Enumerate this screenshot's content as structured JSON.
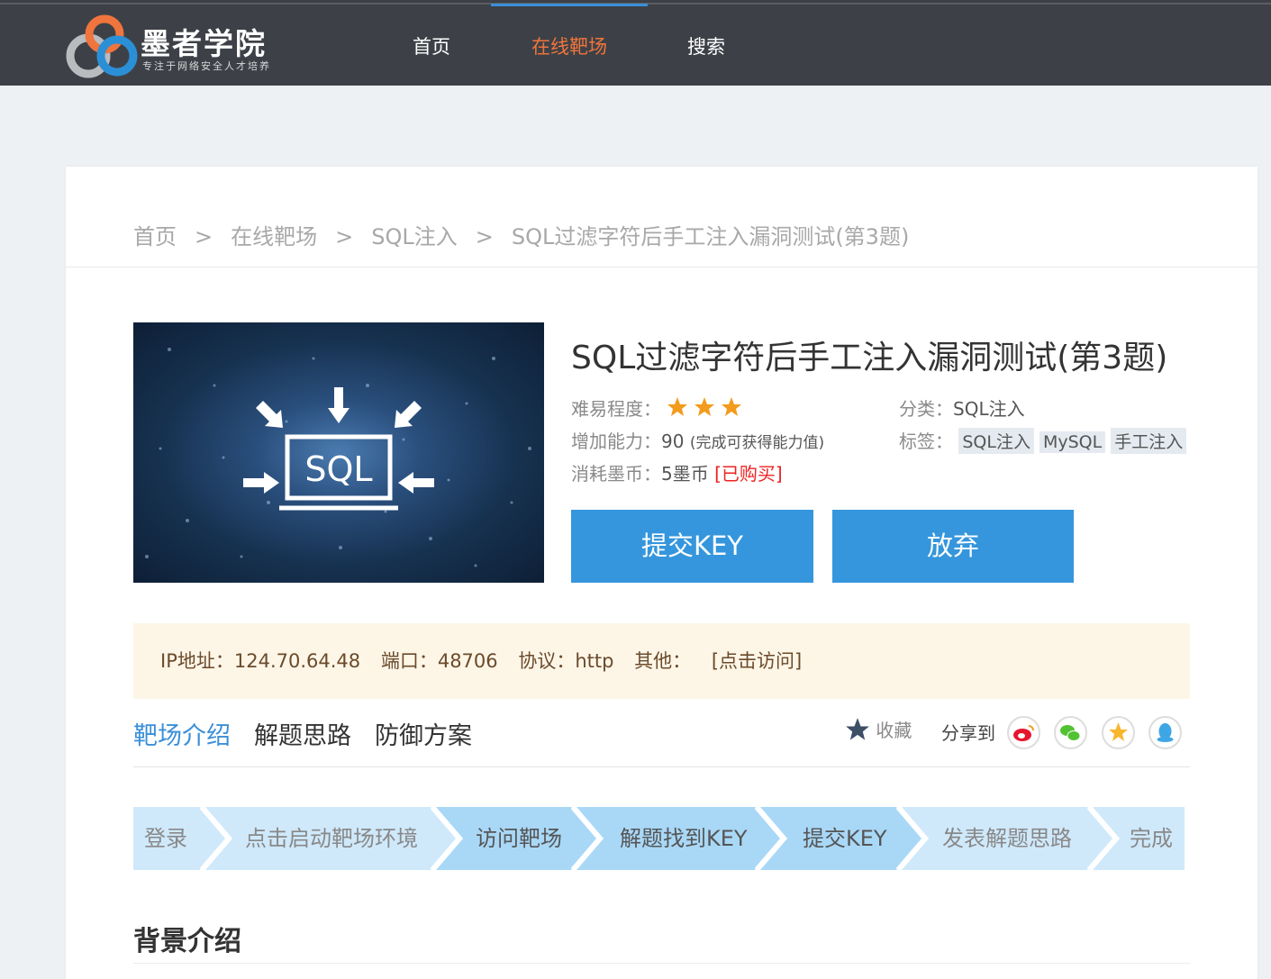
{
  "header": {
    "logo_title": "墨者学院",
    "logo_subtitle": "专注于网络安全人才培养",
    "nav": [
      {
        "label": "首页"
      },
      {
        "label": "在线靶场"
      },
      {
        "label": "搜索"
      }
    ],
    "active_nav": "在线靶场",
    "active_color": "#f0743d"
  },
  "breadcrumb": [
    "首页",
    "在线靶场",
    "SQL注入",
    "SQL过滤字符后手工注入漏洞测试(第3题)"
  ],
  "breadcrumb_sep": ">",
  "hero_image": {
    "text": "SQL"
  },
  "challenge": {
    "title": "SQL过滤字符后手工注入漏洞测试(第3题)",
    "difficulty_label": "难易程度：",
    "difficulty_stars": 3,
    "ability_label": "增加能力：",
    "ability_value": "90",
    "ability_note": "(完成可获得能力值)",
    "cost_label": "消耗墨币：",
    "cost_value": "5墨币",
    "purchased": "[已购买]",
    "category_label": "分类：",
    "category_value": "SQL注入",
    "tags_label": "标签：",
    "tags": [
      "SQL注入",
      "MySQL",
      "手工注入"
    ]
  },
  "buttons": {
    "submit": "提交KEY",
    "abandon": "放弃",
    "color": "#3596dd"
  },
  "target": {
    "ip_label": "IP地址：",
    "ip": "124.70.64.48",
    "port_label": "端口：",
    "port": "48706",
    "protocol_label": "协议：",
    "protocol": "http",
    "other_label": "其他：",
    "visit_link": "[点击访问]"
  },
  "tabs": [
    {
      "label": "靶场介绍"
    },
    {
      "label": "解题思路"
    },
    {
      "label": "防御方案"
    }
  ],
  "active_tab": "靶场介绍",
  "actions": {
    "favorite": "收藏",
    "share_label": "分享到",
    "share_targets": [
      "weibo-icon",
      "wechat-icon",
      "qzone-icon",
      "qq-icon"
    ]
  },
  "steps": [
    "登录",
    "点击启动靶场环境",
    "访问靶场",
    "解题找到KEY",
    "提交KEY",
    "发表解题思路",
    "完成"
  ],
  "section": {
    "title": "背景介绍"
  }
}
